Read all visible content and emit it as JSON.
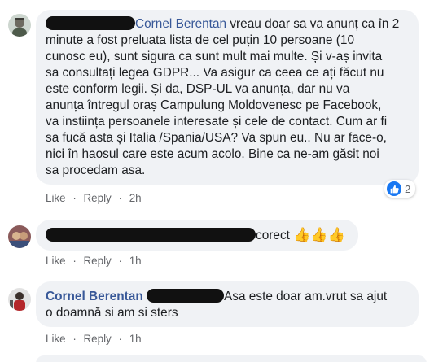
{
  "comments": [
    {
      "author": "Cornel Berentan",
      "lines": [
        "vreau doar sa va anunț ca în 2",
        "minute a fost preluata lista de cel puțin 10 persoane (10",
        "cunosc eu), sunt sigura ca sunt mult mai multe. Și v-aș invita",
        "sa consultați legea GDPR... Va asigur ca ceea ce ați făcut nu",
        "este conform legii. Și da, DSP-UL va anunța, dar nu va",
        "anunța întregul oraș Campulung Moldovenesc pe Facebook,",
        "va instiința persoanele interesate și cele de contact. Cum ar fi",
        "sa fucă asta și Italia /Spania/USA? Va spun eu.. Nu ar face-o,",
        "nici în haosul care este acum acolo. Bine ca ne-am găsit noi",
        "sa procedam asa."
      ],
      "like_label": "Like",
      "reply_label": "Reply",
      "time": "2h",
      "reaction_count": "2",
      "reaction_icon": "thumbs-up-icon"
    },
    {
      "text": "corect",
      "emojis": "👍👍👍",
      "like_label": "Like",
      "reply_label": "Reply",
      "time": "1h"
    },
    {
      "author": "Cornel Berentan",
      "line1": "Asa este doar am.vrut sa ajut",
      "line2": "o doamnă si am si sters",
      "like_label": "Like",
      "reply_label": "Reply",
      "time": "1h"
    }
  ],
  "separator": "·",
  "colors": {
    "bubble": "#f0f2f5",
    "link": "#385898",
    "meta": "#65676b",
    "like_blue": "#1877f2"
  }
}
